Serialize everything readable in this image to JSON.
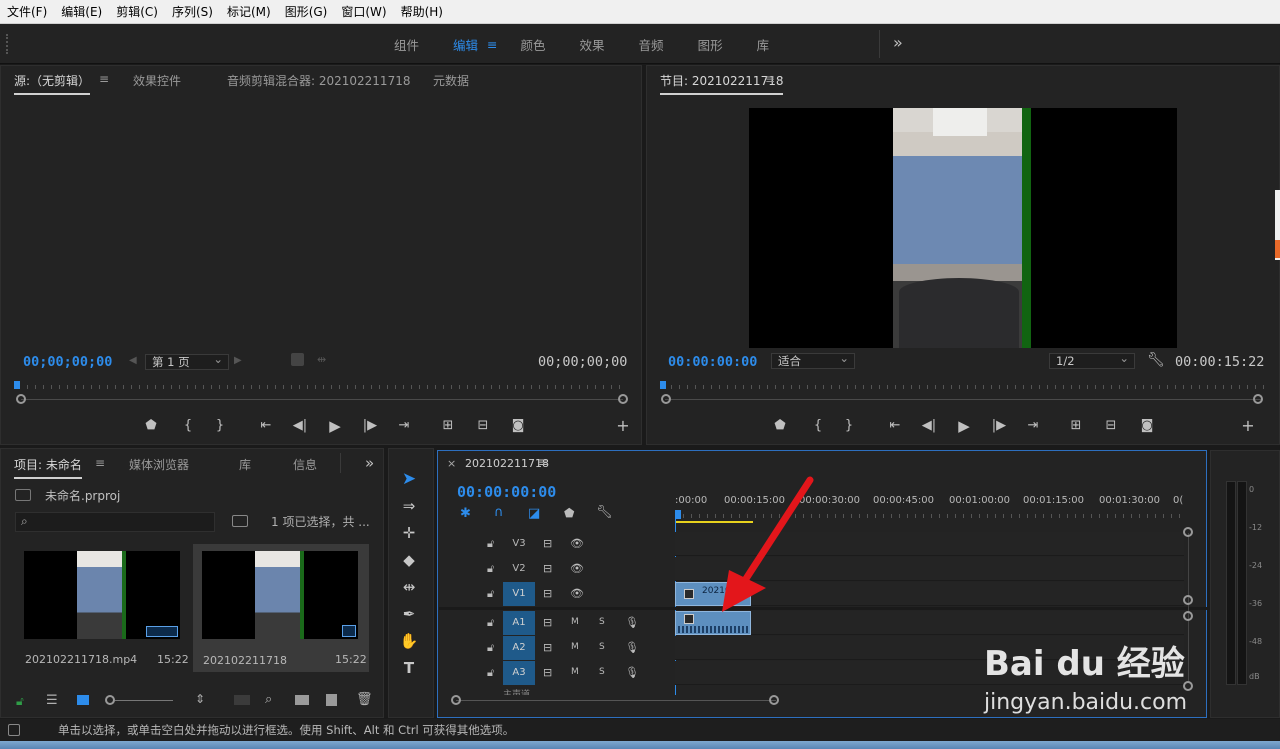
{
  "menu": [
    "文件(F)",
    "编辑(E)",
    "剪辑(C)",
    "序列(S)",
    "标记(M)",
    "图形(G)",
    "窗口(W)",
    "帮助(H)"
  ],
  "workspaces": [
    "组件",
    "编辑",
    "颜色",
    "效果",
    "音频",
    "图形",
    "库"
  ],
  "workspaces_active": "编辑",
  "workspaces_more": "»",
  "source_panel": {
    "tabs": [
      "源:（无剪辑）",
      "效果控件",
      "音频剪辑混合器: 202102211718",
      "元数据"
    ],
    "menu_icon": "≡",
    "tc_left": "00;00;00;00",
    "tc_right": "00;00;00;00",
    "page": "第 1 页"
  },
  "program_panel": {
    "title": "节目: 202102211718",
    "menu_icon": "≡",
    "tc_left": "00:00:00:00",
    "tc_right": "00:00:15:22",
    "fit": "适合",
    "resolution": "1/2"
  },
  "project_panel": {
    "tabs": [
      "项目: 未命名",
      "媒体浏览器",
      "库",
      "信息"
    ],
    "menu_icon": "≡",
    "more": "»",
    "file": "未命名.prproj",
    "selection": "1 项已选择，共 ...",
    "items": [
      {
        "name": "202102211718.mp4",
        "duration": "15:22"
      },
      {
        "name": "202102211718",
        "duration": "15:22"
      }
    ]
  },
  "timeline": {
    "close": "×",
    "title": "202102211718",
    "menu_icon": "≡",
    "tc": "00:00:00:00",
    "ruler": [
      ":00:00",
      "00:00:15:00",
      "00:00:30:00",
      "00:00:45:00",
      "00:01:00:00",
      "00:01:15:00",
      "00:01:30:00",
      "0("
    ],
    "video_tracks": [
      "V3",
      "V2",
      "V1"
    ],
    "audio_tracks": [
      "A1",
      "A2",
      "A3"
    ],
    "m": "M",
    "s": "S",
    "clip_label": "20210",
    "master": "主声道"
  },
  "meter": {
    "scale": [
      "0",
      "-12",
      "-24",
      "-36",
      "-48",
      "dB"
    ]
  },
  "status": "单击以选择，或单击空白处并拖动以进行框选。使用 Shift、Alt 和 Ctrl 可获得其他选项。",
  "watermark": {
    "brand": "Bai du 经验",
    "url": "jingyan.baidu.com"
  },
  "colors": {
    "accent": "#2d8ceb",
    "panel": "#232323",
    "clip_video": "#5d8fbf",
    "arrow": "#e3161b",
    "work_area": "#e8d21d"
  }
}
